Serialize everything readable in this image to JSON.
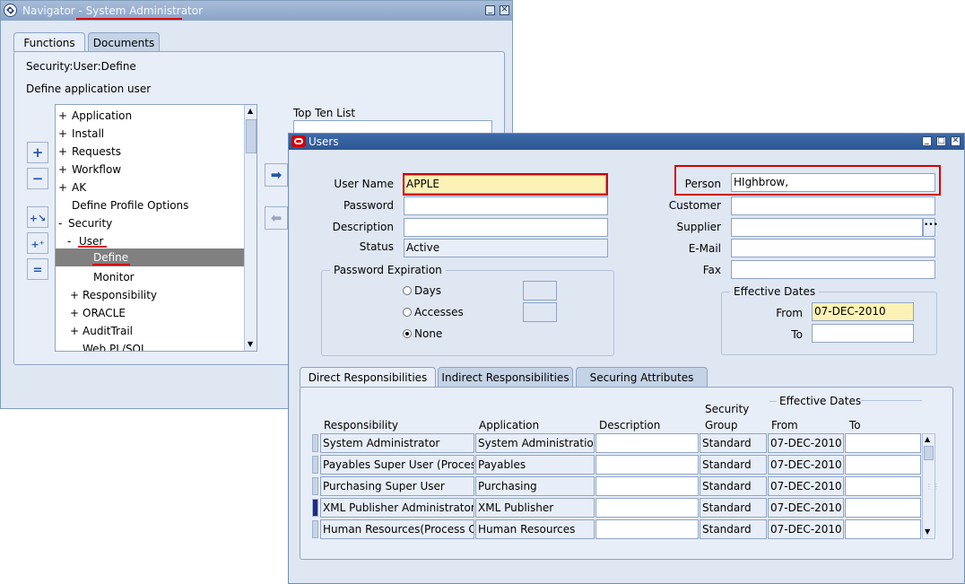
{
  "navigator": {
    "title": "Navigator - System Administrator",
    "tabs": [
      "Functions",
      "Documents"
    ],
    "function_name": "Security:User:Define",
    "function_desc": "Define application user",
    "tree": [
      {
        "prefix": "+",
        "label": "Application"
      },
      {
        "prefix": "+",
        "label": "Install"
      },
      {
        "prefix": "+",
        "label": "Requests"
      },
      {
        "prefix": "+",
        "label": "Workflow"
      },
      {
        "prefix": "+",
        "label": "AK"
      },
      {
        "prefix": "",
        "label": "Define Profile Options"
      },
      {
        "prefix": "-",
        "label": "Security"
      },
      {
        "prefix": "-",
        "label": "User"
      },
      {
        "prefix": "",
        "label": "Define"
      },
      {
        "prefix": "",
        "label": "Monitor"
      },
      {
        "prefix": "+",
        "label": "Responsibility"
      },
      {
        "prefix": "+",
        "label": "ORACLE"
      },
      {
        "prefix": "+",
        "label": "AuditTrail"
      },
      {
        "prefix": "",
        "label": "Web PL/SQL"
      }
    ],
    "top_ten_label": "Top Ten List"
  },
  "users": {
    "title": "Users",
    "labels": {
      "user_name": "User Name",
      "password": "Password",
      "description": "Description",
      "status": "Status",
      "person": "Person",
      "customer": "Customer",
      "supplier": "Supplier",
      "email": "E-Mail",
      "fax": "Fax"
    },
    "values": {
      "user_name": "APPLE",
      "password": "",
      "description": "",
      "status": "Active",
      "person": "HIghbrow,",
      "customer": "",
      "supplier": "",
      "email": "",
      "fax": ""
    },
    "password_expiration": {
      "title": "Password Expiration",
      "options": [
        "Days",
        "Accesses",
        "None"
      ],
      "selected": "None"
    },
    "effective_dates": {
      "title": "Effective Dates",
      "from_label": "From",
      "to_label": "To",
      "from": "07-DEC-2010",
      "to": ""
    },
    "tabs": [
      "Direct Responsibilities",
      "Indirect Responsibilities",
      "Securing Attributes"
    ],
    "grid": {
      "headers": {
        "responsibility": "Responsibility",
        "application": "Application",
        "description": "Description",
        "security_group_1": "Security",
        "security_group_2": "Group",
        "effective_dates": "Effective Dates",
        "from": "From",
        "to": "To"
      },
      "rows": [
        {
          "responsibility": "System Administrator",
          "application": "System Administration",
          "description": "",
          "security_group": "Standard",
          "from": "07-DEC-2010",
          "to": ""
        },
        {
          "responsibility": "Payables Super User (Process",
          "application": "Payables",
          "description": "",
          "security_group": "Standard",
          "from": "07-DEC-2010",
          "to": ""
        },
        {
          "responsibility": "Purchasing Super User",
          "application": "Purchasing",
          "description": "",
          "security_group": "Standard",
          "from": "07-DEC-2010",
          "to": ""
        },
        {
          "responsibility": "XML Publisher Administrator",
          "application": "XML Publisher",
          "description": "",
          "security_group": "Standard",
          "from": "07-DEC-2010",
          "to": ""
        },
        {
          "responsibility": "Human Resources(Process Ce",
          "application": "Human Resources",
          "description": "",
          "security_group": "Standard",
          "from": "07-DEC-2010",
          "to": ""
        }
      ]
    }
  }
}
